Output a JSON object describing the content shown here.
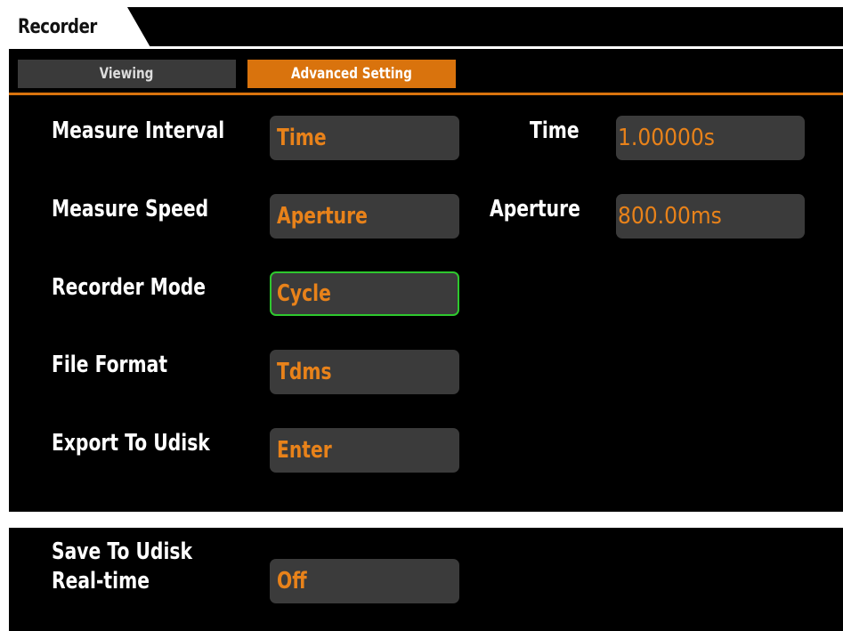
{
  "window": {
    "title": "Recorder"
  },
  "tabs": [
    {
      "label": "Viewing",
      "active": false
    },
    {
      "label": "Advanced Setting",
      "active": true
    }
  ],
  "settings": {
    "measure_interval": {
      "label": "Measure Interval",
      "value": "Time"
    },
    "time": {
      "label": "Time",
      "value": "1.00000s"
    },
    "measure_speed": {
      "label": "Measure Speed",
      "value": "Aperture"
    },
    "aperture": {
      "label": "Aperture",
      "value": "800.00ms"
    },
    "recorder_mode": {
      "label": "Recorder Mode",
      "value": "Cycle",
      "selected": true
    },
    "file_format": {
      "label": "File Format",
      "value": "Tdms"
    },
    "export_to_udisk": {
      "label": "Export To Udisk",
      "value": "Enter"
    },
    "save_realtime": {
      "label_line1": "Save To Udisk",
      "label_line2": "Real-time",
      "value": "Off"
    }
  },
  "colors": {
    "accent": "#d9730d",
    "value_text": "#e8821a",
    "field_bg": "#3b3b3b",
    "selected_border": "#2ec82e",
    "background": "#000000"
  }
}
